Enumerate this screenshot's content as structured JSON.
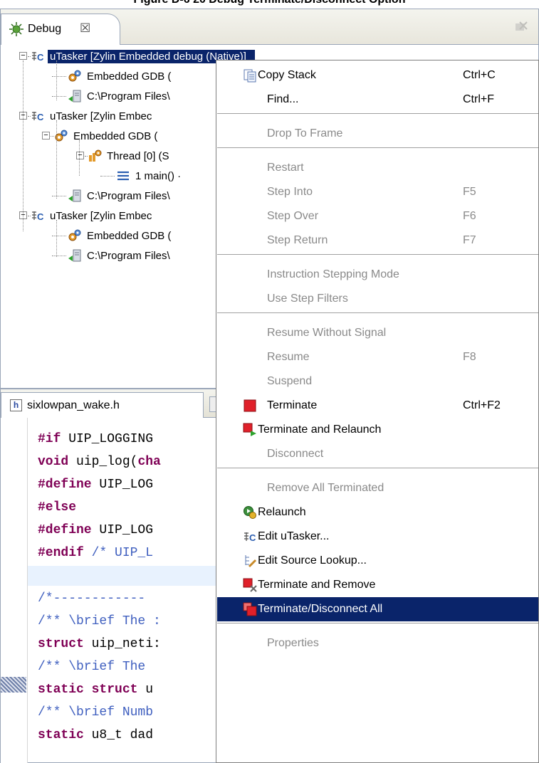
{
  "caption": "Figure D-6 20 Debug Terminate/Disconnect Option",
  "debug_view": {
    "tab_label": "Debug",
    "tab_close": "☒",
    "tree": [
      {
        "label": "uTasker [Zylin Embedded debug (Native)]",
        "icon": "c-launch-icon",
        "selected": true
      },
      {
        "label": "Embedded GDB (",
        "icon": "gears-icon"
      },
      {
        "label": "C:\\Program Files\\",
        "icon": "process-icon"
      },
      {
        "label": "uTasker [Zylin Embec",
        "icon": "c-launch-icon"
      },
      {
        "label": "Embedded GDB (",
        "icon": "gears-icon"
      },
      {
        "label": "Thread [0] (S",
        "icon": "thread-icon"
      },
      {
        "label": "1 main() ·",
        "icon": "stack-frame-icon"
      },
      {
        "label": "C:\\Program Files\\",
        "icon": "process-icon"
      },
      {
        "label": "uTasker [Zylin Embec",
        "icon": "c-launch-icon"
      },
      {
        "label": "Embedded GDB (",
        "icon": "gears-icon"
      },
      {
        "label": "C:\\Program Files\\",
        "icon": "process-icon"
      }
    ]
  },
  "editor": {
    "tab_label": "sixlowpan_wake.h",
    "file_icon_letter": "h",
    "lines": [
      {
        "kw": "#if",
        "rest": " UIP_LOGGING"
      },
      {
        "kw": "void",
        "rest": " uip_log(",
        "kw2": "cha"
      },
      {
        "kw": "#define",
        "rest": " UIP_LOG"
      },
      {
        "kw": "#else",
        "rest": ""
      },
      {
        "kw": "#define",
        "rest": " UIP_LOG"
      },
      {
        "kw": "#endif",
        "rest": "",
        "comment": " /* UIP_L"
      },
      {
        "kw": "",
        "rest": "",
        "highlight": true
      },
      {
        "comment": "/*------------"
      },
      {
        "comment": "/** \\brief The :"
      },
      {
        "kw": "struct",
        "rest": " uip_neti:"
      },
      {
        "comment": "/** \\brief The"
      },
      {
        "kw": "static struct",
        "rest": " u"
      },
      {
        "comment": "/** \\brief Numb"
      },
      {
        "kw": "static",
        "rest": " u8_t dad"
      }
    ]
  },
  "context_menu": {
    "items": [
      {
        "label": "Copy Stack",
        "accel": "Ctrl+C",
        "icon": "copy-icon",
        "tight": true
      },
      {
        "label": "Find...",
        "accel": "Ctrl+F"
      },
      {
        "sep": true
      },
      {
        "label": "Drop To Frame",
        "disabled": true
      },
      {
        "sep": true
      },
      {
        "label": "Restart",
        "disabled": true
      },
      {
        "label": "Step Into",
        "accel": "F5",
        "disabled": true
      },
      {
        "label": "Step Over",
        "accel": "F6",
        "disabled": true
      },
      {
        "label": "Step Return",
        "accel": "F7",
        "disabled": true
      },
      {
        "sep": true
      },
      {
        "label": "Instruction Stepping Mode",
        "disabled": true
      },
      {
        "label": "Use Step Filters",
        "disabled": true
      },
      {
        "sep": true
      },
      {
        "label": "Resume Without Signal",
        "disabled": true
      },
      {
        "label": "Resume",
        "accel": "F8",
        "disabled": true
      },
      {
        "label": "Suspend",
        "disabled": true
      },
      {
        "label": "Terminate",
        "accel": "Ctrl+F2",
        "icon": "terminate-icon"
      },
      {
        "label": "Terminate and Relaunch",
        "icon": "terminate-relaunch-icon",
        "tight": true
      },
      {
        "label": "Disconnect",
        "disabled": true
      },
      {
        "sep": true
      },
      {
        "label": "Remove All Terminated",
        "disabled": true
      },
      {
        "label": "Relaunch",
        "icon": "relaunch-icon",
        "tight": true
      },
      {
        "label": "Edit uTasker...",
        "icon": "c-launch-icon",
        "tight": true
      },
      {
        "label": "Edit Source Lookup...",
        "icon": "source-lookup-icon",
        "tight": true
      },
      {
        "label": "Terminate and Remove",
        "icon": "terminate-remove-icon",
        "tight": true
      },
      {
        "label": "Terminate/Disconnect All",
        "icon": "terminate-all-icon",
        "selected": true,
        "tight": true
      },
      {
        "sep": true
      },
      {
        "label": "Properties",
        "disabled": true
      }
    ]
  },
  "colors": {
    "selection": "#0a246a",
    "keyword": "#7f0055",
    "comment": "#3f5fbf",
    "disabled_text": "#8a8a8a",
    "terminate_red": "#e0202a"
  }
}
